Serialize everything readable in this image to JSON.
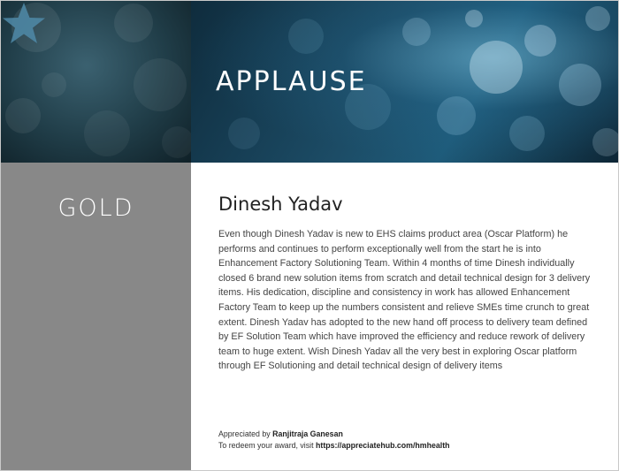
{
  "banner": {
    "title": "APPLAUSE",
    "icon": "star-icon"
  },
  "award": {
    "level": "GOLD"
  },
  "recipient": {
    "name": "Dinesh Yadav"
  },
  "citation": "Even though Dinesh Yadav is new to EHS claims product area (Oscar Platform) he performs and continues to perform exceptionally well from the start he is into Enhancement Factory Solutioning Team. Within 4 months of time Dinesh individually closed 6 brand new solution items from scratch and detail technical design for 3 delivery items. His dedication, discipline and consistency in work has allowed Enhancement Factory Team to keep up the numbers consistent and relieve SMEs time crunch to great extent. Dinesh Yadav has adopted to the new hand off process to delivery team defined by EF Solution Team which have improved the efficiency and reduce rework of delivery team to huge extent. Wish Dinesh Yadav all the very best in exploring Oscar platform through EF Solutioning and detail technical design of delivery items",
  "footer": {
    "appreciated_prefix": "Appreciated by ",
    "appreciated_by": "Ranjitraja Ganesan",
    "redeem_prefix": "To redeem your award, visit ",
    "redeem_url": "https://appreciatehub.com/hmhealth"
  },
  "colors": {
    "gold_panel": "#888888",
    "banner_dark": "#0f2c3d",
    "banner_accent": "#1e5b7a"
  }
}
